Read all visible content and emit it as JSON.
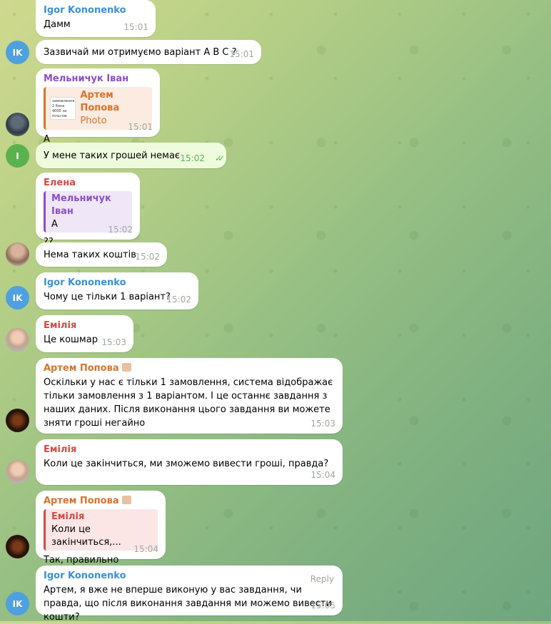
{
  "colors": {
    "blue_name": "#3a8fd6",
    "purple_name": "#8a4fc7",
    "red_name": "#d34b45",
    "orange_name": "#d7732d"
  },
  "messages": [
    {
      "sender": "Igor Kononenko",
      "text": "Дамм",
      "time": "15:01"
    },
    {
      "text": "Зазвичай ми отримуємо варіант A B C ?",
      "time": "15:01",
      "avatar": "IK"
    },
    {
      "sender": "Мельничук Іван",
      "reply_name": "Артем Попова",
      "reply_text": "Photo",
      "reply_thumb": "замовлення 2 бона 4000 за пільгою",
      "text": "A",
      "time": "15:01"
    },
    {
      "text": "У мене таких грошей немає",
      "time": "15:02",
      "avatar": "I",
      "checks": "✓✓"
    },
    {
      "sender": "Елена",
      "reply_name": "Мельничук Іван",
      "reply_text": "A",
      "text": "??",
      "time": "15:02"
    },
    {
      "text": "Нема таких коштів",
      "time": "15:02"
    },
    {
      "sender": "Igor Kononenko",
      "text": "Чому це тільки 1 варіант?",
      "time": "15:02",
      "avatar": "IK"
    },
    {
      "sender": "Емілія",
      "text": "Це кошмар",
      "time": "15:03"
    },
    {
      "sender": "Артем Попова",
      "text": "Оскільки у нас є тільки 1 замовлення, система відображає тільки замовлення з 1 варіантом. І це останнє завдання з наших даних. Після виконання цього завдання ви можете зняти гроші негайно",
      "time": "15:03"
    },
    {
      "sender": "Емілія",
      "text": "Коли це закінчиться, ми зможемо вивести гроші, правда?",
      "time": "15:04"
    },
    {
      "sender": "Артем Попова",
      "reply_name": "Емілія",
      "reply_text": "Коли це закінчиться,...",
      "text": "Так, правильно",
      "time": "15:04"
    },
    {
      "sender": "Igor Kononenko",
      "reply_link": "Reply",
      "text": "Артем, я вже не вперше виконую у вас завдання, чи правда, що після виконання завдання ми можемо вивести кошти?",
      "time": "15:05",
      "avatar": "IK"
    }
  ]
}
